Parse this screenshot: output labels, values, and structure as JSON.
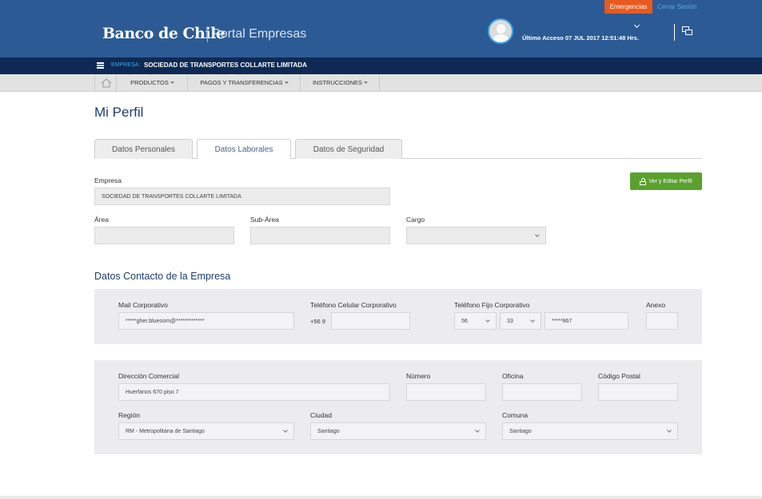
{
  "header": {
    "logo": "Banco de Chile",
    "portal": "Portal Empresas",
    "emergency_label": "Emergencias",
    "logout_label": "Cerrar Sesión",
    "last_access": "Último Acceso 07 JUL 2017 12:51:48 Hrs."
  },
  "company_bar": {
    "label": "EMPRESA:",
    "name": "SOCIEDAD DE TRANSPORTES COLLARTE LIMITADA"
  },
  "nav": {
    "items": [
      {
        "label": "PRODUCTOS"
      },
      {
        "label": "PAGOS Y TRANSFERENCIAS"
      },
      {
        "label": "INSTRUCCIONES"
      }
    ]
  },
  "page": {
    "title": "Mi Perfil",
    "tabs": [
      {
        "label": "Datos Personales"
      },
      {
        "label": "Datos Laborales"
      },
      {
        "label": "Datos de Seguridad"
      }
    ],
    "edit_button": "Ver y Editar Perfil"
  },
  "form": {
    "empresa_label": "Empresa",
    "empresa_value": "SOCIEDAD DE TRANSPORTES COLLARTE LIMITADA",
    "area_label": "Área",
    "area_value": "",
    "subarea_label": "Sub-Área",
    "subarea_value": "",
    "cargo_label": "Cargo",
    "cargo_value": ""
  },
  "contact": {
    "section_title": "Datos Contacto de la Empresa",
    "mail_label": "Mail Corporativo",
    "mail_value": "*****gher.blueoom@*************",
    "cell_label": "Teléfono Celular Corporativo",
    "cell_prefix": "+56 9",
    "cell_value": "",
    "fixed_label": "Teléfono Fijo Corporativo",
    "fixed_country": "56",
    "fixed_area": "33",
    "fixed_value": "*****867",
    "anexo_label": "Anexo",
    "anexo_value": ""
  },
  "address": {
    "direccion_label": "Dirección Comercial",
    "direccion_value": "Huerfanos 670 piso 7",
    "numero_label": "Número",
    "numero_value": "",
    "oficina_label": "Oficina",
    "oficina_value": "",
    "postal_label": "Código Postal",
    "postal_value": "",
    "region_label": "Región",
    "region_value": "RM - Metropolitana de Santiago",
    "ciudad_label": "Ciudad",
    "ciudad_value": "Santiago",
    "comuna_label": "Comuna",
    "comuna_value": "Santiago"
  },
  "colors": {
    "header_bg": "#2c5a94",
    "company_bar_bg": "#0e2a54",
    "emergency": "#e85a1e",
    "accent_green": "#5aa12e",
    "title_blue": "#1d3d6b"
  }
}
